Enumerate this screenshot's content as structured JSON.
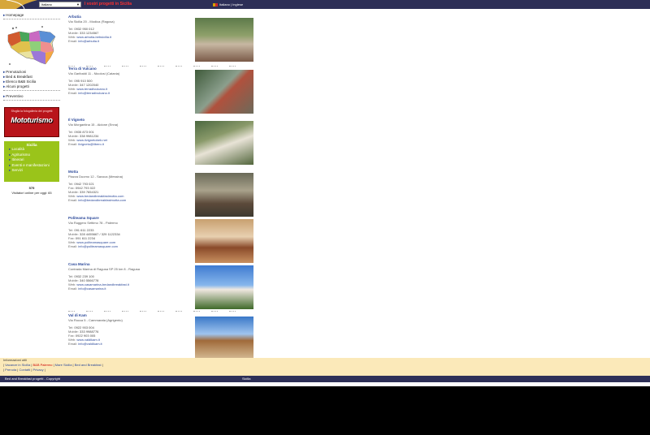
{
  "header": {
    "language_select_value": "Italiano",
    "tagline": "I vostri progetti in Sicilia",
    "top_links": "Italiano | Inglese"
  },
  "sidebar": {
    "home_link": "Homepage",
    "links": [
      "Prenotazioni",
      "Bed & Breakfast",
      "Elenco B&B Sicilia",
      "Alcuni progetti"
    ],
    "preventivo": "Preventivo",
    "promo": {
      "text": "Sfoglia la fotogalleria dei progetti",
      "logo": "Mototurismo"
    },
    "green_box": {
      "title": "Sicilia",
      "items": [
        "Località",
        "Agriturismo",
        "Itinerari",
        "Eventi e manifestazioni",
        "Servizi"
      ]
    },
    "counter": "575",
    "counter_text": "Visitatori online per oggi: 65"
  },
  "listings": [
    {
      "name": "Arbutia",
      "address": "Via Sicilia 20 - Modica (Ragusa)",
      "lines": [
        {
          "label": "Tel:",
          "value": "0932 950 012"
        },
        {
          "label": "Mobile:",
          "value": "333 1234567"
        },
        {
          "label": "Web:",
          "value": "www.arbutia-bebsicilia.it",
          "link": true
        },
        {
          "label": "Email:",
          "value": "info@arbutia.it",
          "link": true
        }
      ]
    },
    {
      "name": "Terra di Vulcano",
      "address": "Via Garibaldi 11 - Nicolosi (Catania)",
      "lines": [
        {
          "label": "Tel:",
          "value": "095 910 500"
        },
        {
          "label": "Mobile:",
          "value": "347 1202040"
        },
        {
          "label": "Web:",
          "value": "www.terradivulcano.it",
          "link": true
        },
        {
          "label": "Email:",
          "value": "info@terradivulcano.it",
          "link": true
        }
      ]
    },
    {
      "name": "Il Vigneto",
      "address": "Via Morgantina 15 - Aidone (Enna)",
      "lines": [
        {
          "label": "Tel:",
          "value": "0935 873 001"
        },
        {
          "label": "Mobile:",
          "value": "338 9981234"
        },
        {
          "label": "Web:",
          "value": "www.ilvignetobeb.net",
          "link": true
        },
        {
          "label": "Email:",
          "value": "ilvigneto@libero.it",
          "link": true
        }
      ]
    },
    {
      "name": "Motta",
      "address": "Piazza Duomo 12 - Savoca (Messina)",
      "lines": [
        {
          "label": "Tel:",
          "value": "0942 793 021"
        },
        {
          "label": "Fax:",
          "value": "0942 793 022"
        },
        {
          "label": "Mobile:",
          "value": "339 7654321"
        },
        {
          "label": "Web:",
          "value": "www.bedandbreakfastmotta.com",
          "link": true
        },
        {
          "label": "Email:",
          "value": "info@bedandbreakfastmotta.com",
          "link": true
        }
      ]
    },
    {
      "name": "Politeama Square",
      "address": "Via Ruggero Settimo 78 - Palermo",
      "lines": [
        {
          "label": "Tel:",
          "value": "091 611 2233"
        },
        {
          "label": "Mobile:",
          "value": "328 4455667 / 329 1122334"
        },
        {
          "label": "Fax:",
          "value": "091 611 2234"
        },
        {
          "label": "Web:",
          "value": "www.politeamasquare.com",
          "link": true
        },
        {
          "label": "Email:",
          "value": "info@politeamasquare.com",
          "link": true
        }
      ]
    },
    {
      "name": "Casa Marina",
      "address": "Contrada Marina di Ragusa SP 25 km 8 - Ragusa",
      "lines": [
        {
          "label": "Tel:",
          "value": "0932 239 100"
        },
        {
          "label": "Mobile:",
          "value": "340 5566778"
        },
        {
          "label": "Web:",
          "value": "www.casamarina-bedandbreakfast.it",
          "link": true
        },
        {
          "label": "Email:",
          "value": "info@casamarina.it",
          "link": true
        }
      ]
    },
    {
      "name": "Val di Kam",
      "address": "Via Rocca 5 - Cammarata (Agrigento)",
      "lines": [
        {
          "label": "Tel:",
          "value": "0922 903 004"
        },
        {
          "label": "Mobile:",
          "value": "333 9988776"
        },
        {
          "label": "Fax:",
          "value": "0922 903 005"
        },
        {
          "label": "Web:",
          "value": "www.valdikam.it",
          "link": true
        },
        {
          "label": "Email:",
          "value": "info@valdikam.it",
          "link": true
        }
      ]
    }
  ],
  "footer": {
    "line1": "Informazioni utili",
    "line2_links": [
      "Vacanze in Sicilia",
      "B&B Palermo",
      "Mare Sicilia",
      "Bed and Breakfast"
    ],
    "line3_links": [
      "Prenota",
      "Contatti",
      "Privacy"
    ]
  },
  "bottom_bar": {
    "left": "Bed and Breakfast progetti - Copyright",
    "center": "Sicilia"
  },
  "colors": {
    "topbar": "#2d2f57",
    "footer_band": "#fbe9b9",
    "promo_red": "#b8141a",
    "green_box": "#9ac41a",
    "link_blue": "#2d4a9a"
  }
}
